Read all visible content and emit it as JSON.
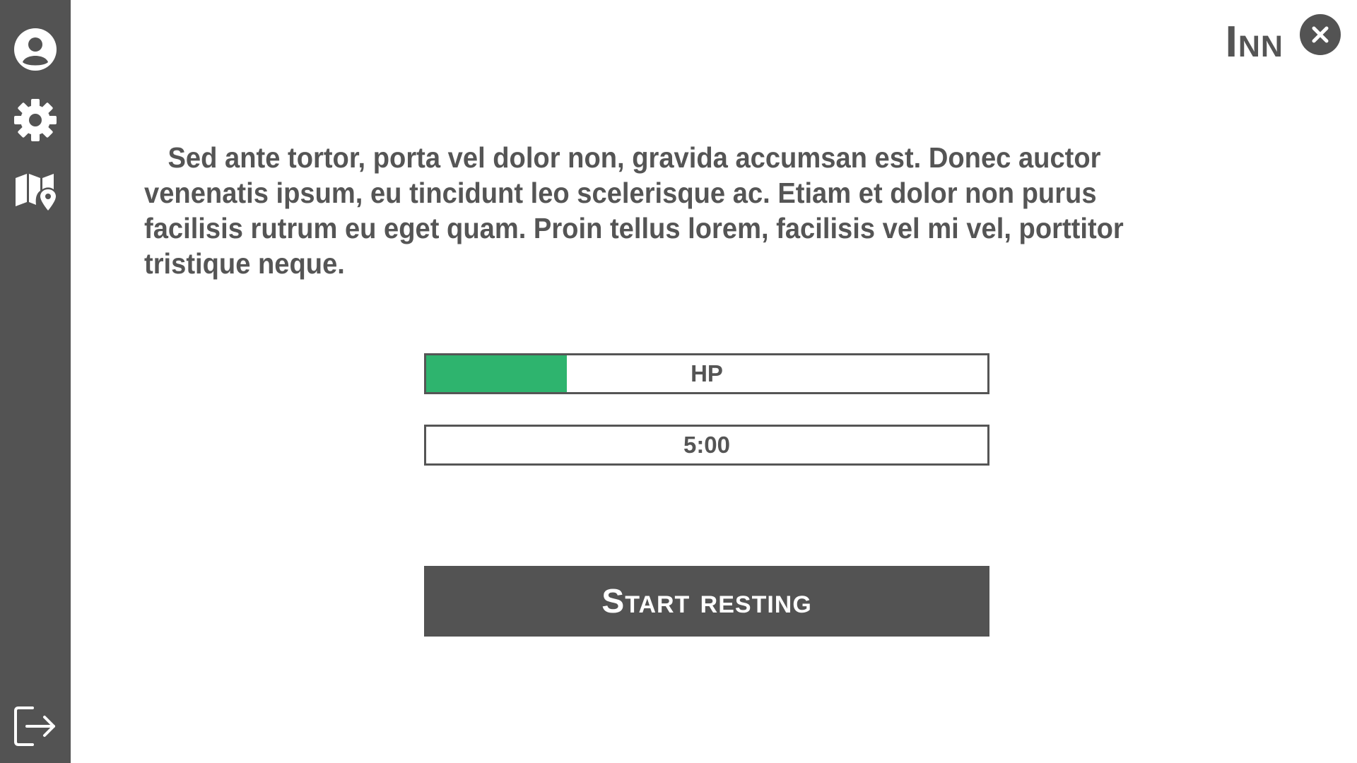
{
  "sidebar": {
    "items": [
      {
        "icon": "profile-icon"
      },
      {
        "icon": "gear-icon"
      },
      {
        "icon": "map-pin-icon"
      }
    ],
    "bottom_item": {
      "icon": "logout-icon"
    }
  },
  "header": {
    "title": "Inn",
    "close_icon": "close-icon"
  },
  "main": {
    "description": "Sed ante tortor, porta vel dolor non, gravida accumsan est. Donec auctor venenatis ipsum, eu tincidunt leo scelerisque ac. Etiam et dolor non purus facilisis rutrum eu eget quam. Proin tellus lorem, facilisis vel mi vel, porttitor tristique neque.",
    "hp_bar": {
      "label": "HP",
      "fill_fraction": 0.25,
      "fill_color": "#2eb46e"
    },
    "timer_bar": {
      "label": "5:00"
    },
    "start_button_label": "Start resting"
  },
  "colors": {
    "sidebar": "#535353",
    "text": "#555555",
    "accent": "#2eb46e",
    "background": "#ffffff"
  }
}
